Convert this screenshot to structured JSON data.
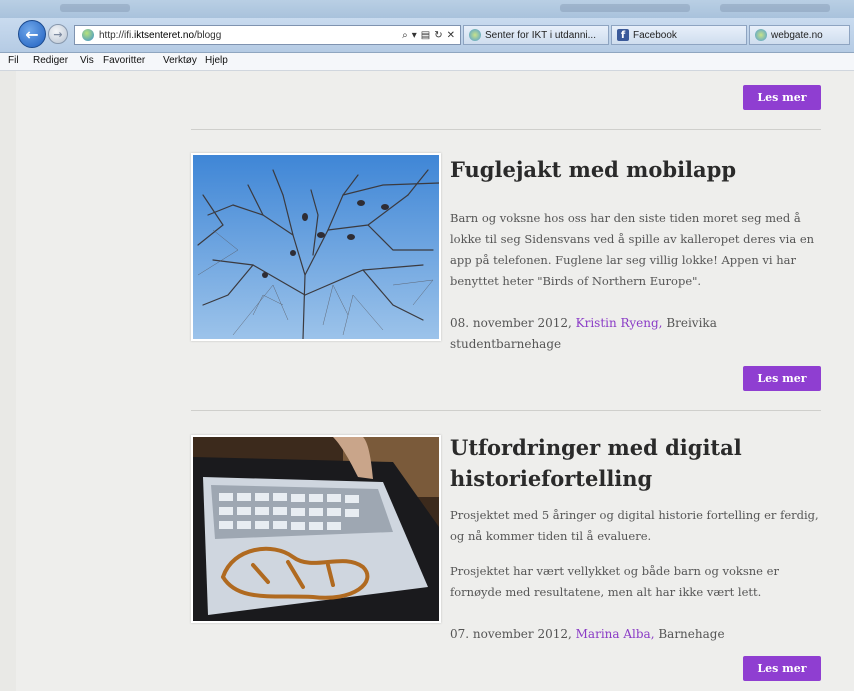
{
  "browser": {
    "url_prefix": "http://ifi.",
    "url_domain": "iktsenteret.no",
    "url_path": "/blogg",
    "address_icons": [
      "search-icon",
      "dropdown-icon",
      "compat-icon",
      "refresh-icon",
      "stop-icon"
    ],
    "tabs": [
      {
        "label": "Senter for IKT i utdanni...",
        "icon": "site-favicon"
      },
      {
        "label": "Facebook",
        "icon": "facebook-icon"
      },
      {
        "label": "webgate.no",
        "icon": "site-favicon"
      }
    ],
    "menu": [
      "Fil",
      "Rediger",
      "Vis",
      "Favoritter",
      "Verktøy",
      "Hjelp"
    ]
  },
  "readmore_label": "Les mer",
  "posts": [
    {
      "title": "Fuglejakt med mobilapp",
      "paragraphs": [
        "Barn og voksne hos oss har den siste tiden moret seg med å lokke til seg Sidensvans ved å spille av kalleropet deres via en app på telefonen. Fuglene lar seg villig lokke! Appen vi har benyttet heter \"Birds of Northern Europe\"."
      ],
      "date": "08. november 2012,",
      "author": "Kristin Ryeng,",
      "org": "Breivika studentbarnehage"
    },
    {
      "title": "Utfordringer med digital historiefortelling",
      "paragraphs": [
        "Prosjektet med 5 åringer og digital historie fortelling er ferdig, og nå kommer tiden til å evaluere.",
        "Prosjektet har vært vellykket og både barn og voksne er fornøyde med resultatene, men alt har ikke vært lett."
      ],
      "date": "07. november 2012,",
      "author": "Marina Alba,",
      "org": "Barnehage"
    }
  ],
  "colors": {
    "accent": "#8f3ed1",
    "link": "#8a3bc6",
    "page_bg": "#eeeeec",
    "title": "#2a2a2a"
  }
}
